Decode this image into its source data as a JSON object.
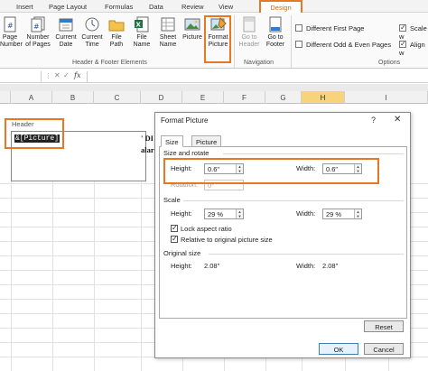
{
  "ribbon": {
    "tabs": [
      "Insert",
      "Page Layout",
      "Formulas",
      "Data",
      "Review",
      "View"
    ],
    "active_tab": "Design",
    "buttons": [
      {
        "key": "page_number",
        "label": "Page\nNumber"
      },
      {
        "key": "number_of_pages",
        "label": "Number\nof Pages"
      },
      {
        "key": "current_date",
        "label": "Current\nDate"
      },
      {
        "key": "current_time",
        "label": "Current\nTime"
      },
      {
        "key": "file_path",
        "label": "File\nPath"
      },
      {
        "key": "file_name",
        "label": "File\nName"
      },
      {
        "key": "sheet_name",
        "label": "Sheet\nName"
      },
      {
        "key": "picture",
        "label": "Picture"
      },
      {
        "key": "format_picture",
        "label": "Format\nPicture"
      },
      {
        "key": "go_to_header",
        "label": "Go to\nHeader"
      },
      {
        "key": "go_to_footer",
        "label": "Go to\nFooter"
      }
    ],
    "groups": {
      "header_footer": "Header & Footer Elements",
      "navigation": "Navigation",
      "options": "Options"
    },
    "options": {
      "different_first_page": "Different First Page",
      "different_odd_even": "Different Odd & Even Pages",
      "scale_with": "Scale w",
      "align_with": "Align w"
    }
  },
  "formula_bar": {
    "fx": "fx"
  },
  "columns": [
    "A",
    "B",
    "C",
    "D",
    "E",
    "F",
    "G",
    "H",
    "I"
  ],
  "selected_column": "H",
  "sheet": {
    "header_label": "Header",
    "header_code": "&[Picture]",
    "peek_line1": "' DI",
    "peek_line2": "alar"
  },
  "dialog": {
    "title": "Format Picture",
    "help": "?",
    "close": "✕",
    "tabs": [
      "Size",
      "Picture"
    ],
    "size_and_rotate": "Size and rotate",
    "height_label": "Height:",
    "height_value": "0.6\"",
    "width_label": "Width:",
    "width_value": "0.6\"",
    "rotation_label": "Rotation:",
    "rotation_value": "0°",
    "scale": "Scale",
    "scale_height_label": "Height:",
    "scale_height_value": "29 %",
    "scale_width_label": "Width:",
    "scale_width_value": "29 %",
    "lock_aspect": "Lock aspect ratio",
    "relative_original": "Relative to original picture size",
    "original_size": "Original size",
    "orig_height_label": "Height:",
    "orig_height_value": "2.08\"",
    "orig_width_label": "Width:",
    "orig_width_value": "2.08\"",
    "reset": "Reset",
    "ok": "OK",
    "cancel": "Cancel"
  },
  "colors": {
    "highlight": "#e87722",
    "selected_column": "#f7d47a"
  }
}
